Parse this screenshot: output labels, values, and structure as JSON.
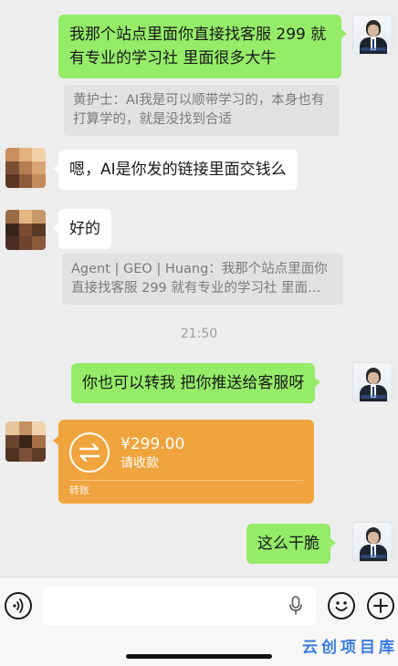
{
  "messages": {
    "m1": {
      "text": "我那个站点里面你直接找客服 299 就有专业的学习社 里面很多大牛"
    },
    "q1": {
      "text": "黄护士：AI我是可以顺带学习的，本身也有打算学的，就是没找到合适"
    },
    "m2": {
      "text": "嗯，AI是你发的链接里面交钱么"
    },
    "m3": {
      "text": "好的"
    },
    "q2": {
      "text": "Agent | GEO | Huang：我那个站点里面你直接找客服 299 就有专业的学习社 里面…"
    },
    "timestamp": "21:50",
    "m4": {
      "text": "你也可以转我 把你推送给客服呀"
    },
    "transfer": {
      "amount": "¥299.00",
      "status": "请收款",
      "label": "转账"
    },
    "m5": {
      "text": "这么干脆"
    }
  },
  "input_bar": {
    "voice_icon": "voice-icon",
    "mic_icon": "microphone-icon",
    "emoji_icon": "emoji-icon",
    "plus_icon": "plus-icon"
  },
  "watermark": "云创项目库",
  "colors": {
    "bubble_green": "#95ec69",
    "bubble_white": "#ffffff",
    "transfer_orange": "#f0a43e",
    "background": "#ededed",
    "watermark": "#3a7be0"
  }
}
